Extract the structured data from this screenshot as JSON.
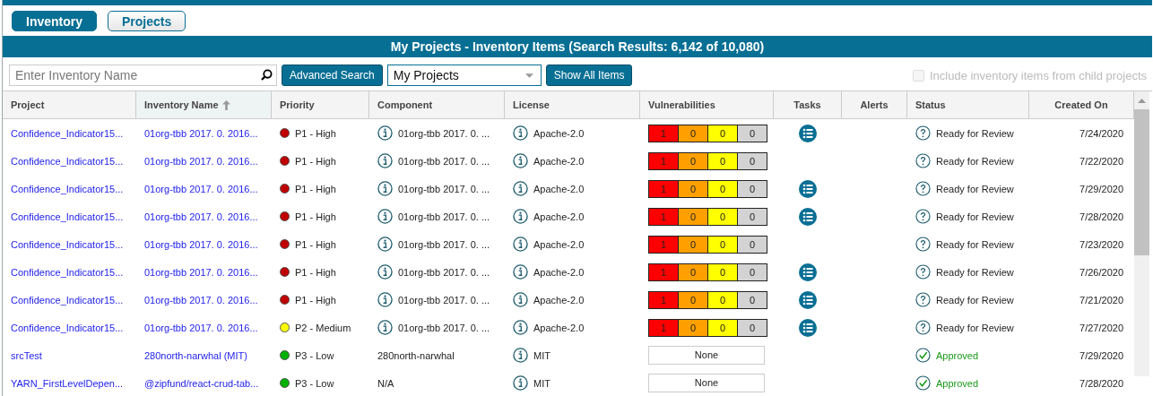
{
  "tabs": [
    {
      "label": "Inventory",
      "selected": true
    },
    {
      "label": "Projects",
      "selected": false
    }
  ],
  "title": "My Projects - Inventory Items (Search Results: 6,142 of 10,080)",
  "toolbar": {
    "search": {
      "placeholder": "Enter Inventory Name"
    },
    "advanced_button": "Advanced Search",
    "scope_select": {
      "value": "My Projects"
    },
    "show_all_button": "Show All Items",
    "include_child": {
      "label": "Include inventory items from child projects",
      "checked": false,
      "disabled": true
    }
  },
  "table": {
    "columns": [
      {
        "label": "Project",
        "sorted": false
      },
      {
        "label": "Inventory Name",
        "sorted": true
      },
      {
        "label": "Priority",
        "sorted": false
      },
      {
        "label": "Component",
        "sorted": false
      },
      {
        "label": "License",
        "sorted": false
      },
      {
        "label": "Vulnerabilities",
        "sorted": false
      },
      {
        "label": "Tasks",
        "sorted": false
      },
      {
        "label": "Alerts",
        "sorted": false
      },
      {
        "label": "Status",
        "sorted": false
      },
      {
        "label": "Created On",
        "sorted": false
      }
    ],
    "rows": [
      {
        "project": "Confidence_Indicator15...",
        "inventory": "01org-tbb 2017. 0. 2016...",
        "priority": {
          "label": "P1 - High",
          "color": "#c00000"
        },
        "component": {
          "text": "01org-tbb 2017. 0. ...",
          "info": true
        },
        "license": "Apache-2.0",
        "vulnerabilities": {
          "kind": "counts",
          "values": [
            "1",
            "0",
            "0",
            "0"
          ]
        },
        "tasks": true,
        "status": {
          "kind": "review",
          "label": "Ready for Review"
        },
        "created": "7/24/2020"
      },
      {
        "project": "Confidence_Indicator15...",
        "inventory": "01org-tbb 2017. 0. 2016...",
        "priority": {
          "label": "P1 - High",
          "color": "#c00000"
        },
        "component": {
          "text": "01org-tbb 2017. 0. ...",
          "info": true
        },
        "license": "Apache-2.0",
        "vulnerabilities": {
          "kind": "counts",
          "values": [
            "1",
            "0",
            "0",
            "0"
          ]
        },
        "tasks": false,
        "status": {
          "kind": "review",
          "label": "Ready for Review"
        },
        "created": "7/22/2020"
      },
      {
        "project": "Confidence_Indicator15...",
        "inventory": "01org-tbb 2017. 0. 2016...",
        "priority": {
          "label": "P1 - High",
          "color": "#c00000"
        },
        "component": {
          "text": "01org-tbb 2017. 0. ...",
          "info": true
        },
        "license": "Apache-2.0",
        "vulnerabilities": {
          "kind": "counts",
          "values": [
            "1",
            "0",
            "0",
            "0"
          ]
        },
        "tasks": true,
        "status": {
          "kind": "review",
          "label": "Ready for Review"
        },
        "created": "7/29/2020"
      },
      {
        "project": "Confidence_Indicator15...",
        "inventory": "01org-tbb 2017. 0. 2016...",
        "priority": {
          "label": "P1 - High",
          "color": "#c00000"
        },
        "component": {
          "text": "01org-tbb 2017. 0. ...",
          "info": true
        },
        "license": "Apache-2.0",
        "vulnerabilities": {
          "kind": "counts",
          "values": [
            "1",
            "0",
            "0",
            "0"
          ]
        },
        "tasks": true,
        "status": {
          "kind": "review",
          "label": "Ready for Review"
        },
        "created": "7/28/2020"
      },
      {
        "project": "Confidence_Indicator15...",
        "inventory": "01org-tbb 2017. 0. 2016...",
        "priority": {
          "label": "P1 - High",
          "color": "#c00000"
        },
        "component": {
          "text": "01org-tbb 2017. 0. ...",
          "info": true
        },
        "license": "Apache-2.0",
        "vulnerabilities": {
          "kind": "counts",
          "values": [
            "1",
            "0",
            "0",
            "0"
          ]
        },
        "tasks": false,
        "status": {
          "kind": "review",
          "label": "Ready for Review"
        },
        "created": "7/23/2020"
      },
      {
        "project": "Confidence_Indicator15...",
        "inventory": "01org-tbb 2017. 0. 2016...",
        "priority": {
          "label": "P1 - High",
          "color": "#c00000"
        },
        "component": {
          "text": "01org-tbb 2017. 0. ...",
          "info": true
        },
        "license": "Apache-2.0",
        "vulnerabilities": {
          "kind": "counts",
          "values": [
            "1",
            "0",
            "0",
            "0"
          ]
        },
        "tasks": true,
        "status": {
          "kind": "review",
          "label": "Ready for Review"
        },
        "created": "7/26/2020"
      },
      {
        "project": "Confidence_Indicator15...",
        "inventory": "01org-tbb 2017. 0. 2016...",
        "priority": {
          "label": "P1 - High",
          "color": "#c00000"
        },
        "component": {
          "text": "01org-tbb 2017. 0. ...",
          "info": true
        },
        "license": "Apache-2.0",
        "vulnerabilities": {
          "kind": "counts",
          "values": [
            "1",
            "0",
            "0",
            "0"
          ]
        },
        "tasks": true,
        "status": {
          "kind": "review",
          "label": "Ready for Review"
        },
        "created": "7/21/2020"
      },
      {
        "project": "Confidence_Indicator15...",
        "inventory": "01org-tbb 2017. 0. 2016...",
        "priority": {
          "label": "P2 - Medium",
          "color": "#ffff00"
        },
        "component": {
          "text": "01org-tbb 2017. 0. ...",
          "info": true
        },
        "license": "Apache-2.0",
        "vulnerabilities": {
          "kind": "counts",
          "values": [
            "1",
            "0",
            "0",
            "0"
          ]
        },
        "tasks": true,
        "status": {
          "kind": "review",
          "label": "Ready for Review"
        },
        "created": "7/27/2020"
      },
      {
        "project": "srcTest",
        "inventory": "280north-narwhal (MIT)",
        "priority": {
          "label": "P3 - Low",
          "color": "#00b000"
        },
        "component": {
          "text": "280north-narwhal",
          "info": false
        },
        "license": "MIT",
        "vulnerabilities": {
          "kind": "none",
          "text": "None"
        },
        "tasks": false,
        "status": {
          "kind": "approved",
          "label": "Approved"
        },
        "created": "7/29/2020"
      },
      {
        "project": "YARN_FirstLevelDepen...",
        "inventory": "@zipfund/react-crud-tab...",
        "priority": {
          "label": "P3 - Low",
          "color": "#00b000"
        },
        "component": {
          "text": "N/A",
          "info": false
        },
        "license": "MIT",
        "vulnerabilities": {
          "kind": "none",
          "text": "None"
        },
        "tasks": false,
        "status": {
          "kind": "approved",
          "label": "Approved"
        },
        "created": "7/28/2020"
      }
    ]
  }
}
